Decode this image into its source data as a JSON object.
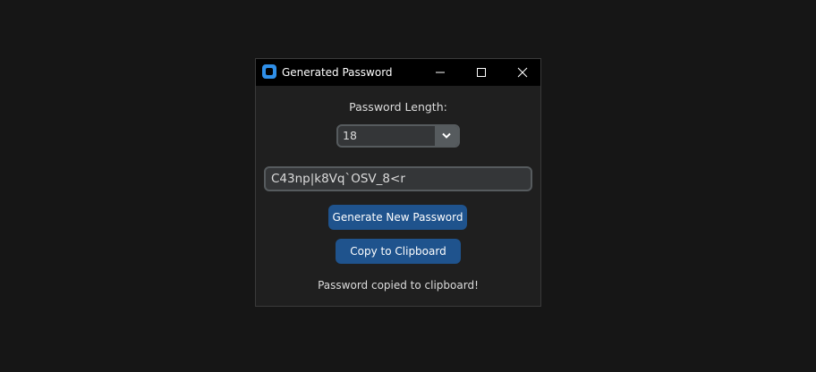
{
  "window": {
    "title": "Generated Password"
  },
  "length": {
    "label": "Password Length:",
    "selected": "18"
  },
  "password": {
    "value": "C43np|k8Vq`OSV_8<r"
  },
  "buttons": {
    "generate_label": "Generate New Password",
    "copy_label": "Copy to Clipboard"
  },
  "status": {
    "message": "Password copied to clipboard!"
  },
  "colors": {
    "accent": "#1f538d",
    "app_icon": "#2f8fe8",
    "field_bg": "#343638",
    "field_border": "#565b5e",
    "window_bg": "#1f1f1f",
    "titlebar_bg": "#000000"
  },
  "icons": {
    "app": "app-icon",
    "minimize": "minimize-icon",
    "maximize": "maximize-icon",
    "close": "close-icon",
    "dropdown": "chevron-down-icon"
  }
}
